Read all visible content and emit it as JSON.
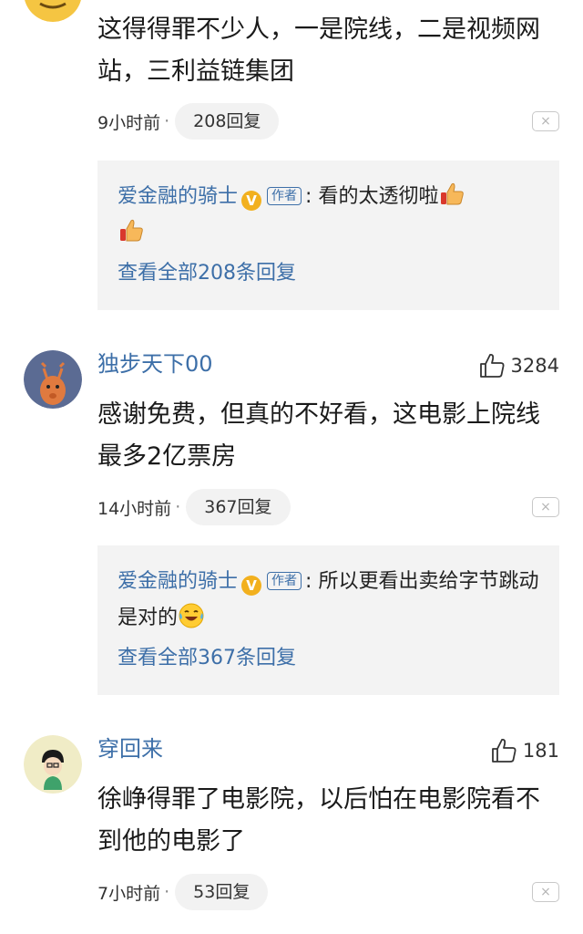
{
  "comments": [
    {
      "username": "",
      "likes": "",
      "text": "这得得罪不少人，一是院线，二是视频网站，三利益链集团",
      "time": "9小时前",
      "dot": "·",
      "replies_label": "208回复",
      "close_label": "×",
      "reply": {
        "author": "爱金融的骑士",
        "verified_glyph": "V",
        "author_tag": "作者",
        "separator": ":",
        "text": "看的太透彻啦",
        "view_all": "查看全部208条回复"
      }
    },
    {
      "username": "独步天下00",
      "likes": "3284",
      "text": "感谢免费，但真的不好看，这电影上院线最多2亿票房",
      "time": "14小时前",
      "dot": "·",
      "replies_label": "367回复",
      "close_label": "×",
      "reply": {
        "author": "爱金融的骑士",
        "verified_glyph": "V",
        "author_tag": "作者",
        "separator": ":",
        "text": "所以更看出卖给字节跳动是对的",
        "view_all": "查看全部367条回复"
      }
    },
    {
      "username": "穿回来",
      "likes": "181",
      "text": "徐峥得罪了电影院，以后怕在电影院看不到他的电影了",
      "time": "7小时前",
      "dot": "·",
      "replies_label": "53回复",
      "close_label": "×"
    }
  ],
  "colors": {
    "username": "#3d6fa8",
    "reply_box_bg": "#f3f3f3",
    "pill_bg": "#f2f2f2",
    "verified_badge": "#f2b01e"
  },
  "icons": {
    "like": "thumbs-up-outline-icon",
    "reply_emoji_1": "thumbs-up-emoji-icon",
    "reply_emoji_2": "laughing-tears-emoji-icon",
    "close": "close-icon"
  }
}
